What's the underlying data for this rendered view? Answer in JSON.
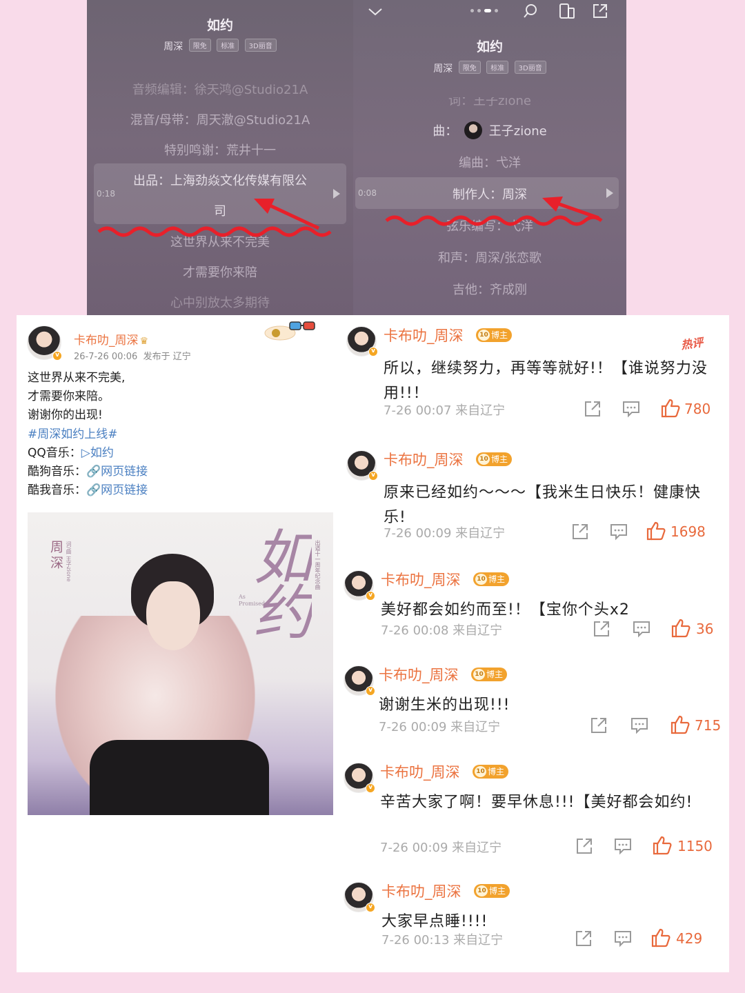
{
  "player_left": {
    "song_title": "如约",
    "artist": "周深",
    "tags": [
      "限免",
      "标准",
      "3D丽音"
    ],
    "credits": [
      "音频编辑：徐天鸿@Studio21A",
      "混音/母带：周天澈@Studio21A",
      "特别鸣谢：荒井十一",
      "出品：上海劲焱文化传媒有限公",
      "司"
    ],
    "lyrics": [
      "这世界从来不完美",
      "才需要你来陪",
      "心中别放太多期待"
    ],
    "current_time": "0:18"
  },
  "player_right": {
    "song_title": "如约",
    "artist": "周深",
    "tags": [
      "限免",
      "标准",
      "3D丽音"
    ],
    "partial_top": "词：王子zione",
    "composer_label": "曲：",
    "composer": "王子zione",
    "arranger": "编曲：弋洋",
    "producer": "制作人：周深",
    "strings": "弦乐编写：弋洋",
    "harmony": "和声：周深/张恋歌",
    "guitar": "吉他：齐成刚",
    "current_time": "0:08"
  },
  "post": {
    "username": "卡布叻_周深",
    "time": "26-7-26 00:06",
    "location": "发布于 辽宁",
    "lines": [
      "这世界从来不完美,",
      "才需要你来陪。",
      "谢谢你的出现!"
    ],
    "hashtag": "#周深如约上线#",
    "qq_label": "QQ音乐：",
    "qq_link": "▷如约",
    "kugou_label": "酷狗音乐：",
    "kugou_link": "网页链接",
    "kuwo_label": "酷我音乐：",
    "kuwo_link": "网页链接",
    "cover": {
      "artist": "周深",
      "small_credit": "词/曲 王子zione",
      "title": "如约",
      "english": "As Promised",
      "right_text": "出道十一周年纪念曲"
    }
  },
  "hot_label": "热评",
  "badge_label": "博主",
  "comments": [
    {
      "name": "卡布叻_周深",
      "text": "所以，继续努力，再等等就好!！【谁说努力没用!!！",
      "time": "7-26 00:07 来自辽宁",
      "likes": "780"
    },
    {
      "name": "卡布叻_周深",
      "text": "原来已经如约～～～【我米生日快乐！健康快乐!",
      "time": "7-26 00:09 来自辽宁",
      "likes": "1698"
    },
    {
      "name": "卡布叻_周深",
      "text": "美好都会如约而至!！【宝你个头x2",
      "time": "7-26 00:08 来自辽宁",
      "likes": "36"
    },
    {
      "name": "卡布叻_周深",
      "text": "谢谢生米的出现!!!",
      "time": "7-26 00:09 来自辽宁",
      "likes": "715"
    },
    {
      "name": "卡布叻_周深",
      "text": "辛苦大家了啊！要早休息!!!【美好都会如约!",
      "time": "7-26 00:09 来自辽宁",
      "likes": "1150"
    },
    {
      "name": "卡布叻_周深",
      "text": "大家早点睡!!!!",
      "time": "7-26 00:13 来自辽宁",
      "likes": "429"
    }
  ],
  "colors": {
    "page_bg": "#f9dbea",
    "username": "#eb7340",
    "link": "#4a7fc1",
    "annotation": "#e8202a",
    "like": "#e8693c"
  }
}
